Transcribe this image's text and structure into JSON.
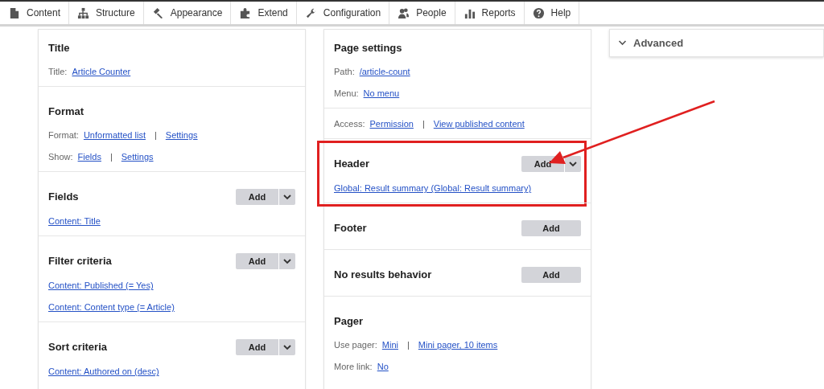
{
  "toolbar": [
    {
      "label": "Content"
    },
    {
      "label": "Structure"
    },
    {
      "label": "Appearance"
    },
    {
      "label": "Extend"
    },
    {
      "label": "Configuration"
    },
    {
      "label": "People"
    },
    {
      "label": "Reports"
    },
    {
      "label": "Help"
    }
  ],
  "columns": [
    {
      "sections": [
        {
          "title": "Title",
          "rows": [
            {
              "parts": [
                {
                  "kind": "label",
                  "text": "Title:"
                },
                {
                  "kind": "link",
                  "text": "Article Counter"
                }
              ]
            }
          ]
        },
        {
          "title": "Format",
          "rows": [
            {
              "parts": [
                {
                  "kind": "label",
                  "text": "Format:"
                },
                {
                  "kind": "link",
                  "text": "Unformatted list"
                },
                {
                  "kind": "separator",
                  "text": "|"
                },
                {
                  "kind": "link",
                  "text": "Settings"
                }
              ]
            },
            {
              "parts": [
                {
                  "kind": "label",
                  "text": "Show:"
                },
                {
                  "kind": "link",
                  "text": "Fields"
                },
                {
                  "kind": "separator",
                  "text": "|"
                },
                {
                  "kind": "link",
                  "text": "Settings"
                }
              ]
            }
          ]
        },
        {
          "title": "Fields",
          "button": {
            "label": "Add",
            "dropdown": true
          },
          "rows": [
            {
              "parts": [
                {
                  "kind": "link",
                  "text": "Content: Title"
                }
              ]
            }
          ]
        },
        {
          "title": "Filter criteria",
          "button": {
            "label": "Add",
            "dropdown": true
          },
          "rows": [
            {
              "parts": [
                {
                  "kind": "link",
                  "text": "Content: Published (= Yes)"
                }
              ]
            },
            {
              "parts": [
                {
                  "kind": "link",
                  "text": "Content: Content type (= Article)"
                }
              ]
            }
          ]
        },
        {
          "title": "Sort criteria",
          "button": {
            "label": "Add",
            "dropdown": true
          },
          "rows": [
            {
              "parts": [
                {
                  "kind": "link",
                  "text": "Content: Authored on (desc)"
                }
              ]
            }
          ]
        }
      ]
    },
    {
      "sections": [
        {
          "title": "Page settings",
          "rows": [
            {
              "parts": [
                {
                  "kind": "label",
                  "text": "Path:"
                },
                {
                  "kind": "link",
                  "text": "/article-count"
                }
              ]
            },
            {
              "parts": [
                {
                  "kind": "label",
                  "text": "Menu:"
                },
                {
                  "kind": "link",
                  "text": "No menu"
                }
              ]
            }
          ]
        },
        {
          "rows": [
            {
              "parts": [
                {
                  "kind": "label",
                  "text": "Access:"
                },
                {
                  "kind": "link",
                  "text": "Permission"
                },
                {
                  "kind": "separator",
                  "text": "|"
                },
                {
                  "kind": "link",
                  "text": "View published content"
                }
              ]
            }
          ]
        },
        {
          "title": "Header",
          "highlighted": true,
          "button": {
            "label": "Add",
            "dropdown": true
          },
          "rows": [
            {
              "parts": [
                {
                  "kind": "link",
                  "text": "Global: Result summary (Global: Result summary)"
                }
              ]
            }
          ]
        },
        {
          "title": "Footer",
          "button": {
            "label": "Add",
            "dropdown": false
          }
        },
        {
          "title": "No results behavior",
          "button": {
            "label": "Add",
            "dropdown": false
          }
        },
        {
          "title": "Pager",
          "rows": [
            {
              "parts": [
                {
                  "kind": "label",
                  "text": "Use pager:"
                },
                {
                  "kind": "link",
                  "text": "Mini"
                },
                {
                  "kind": "separator",
                  "text": "|"
                },
                {
                  "kind": "link",
                  "text": "Mini pager, 10 items"
                }
              ]
            },
            {
              "parts": [
                {
                  "kind": "label",
                  "text": "More link:"
                },
                {
                  "kind": "link",
                  "text": "No"
                }
              ]
            }
          ]
        }
      ]
    }
  ],
  "advanced": {
    "title": "Advanced",
    "expanded": false
  }
}
